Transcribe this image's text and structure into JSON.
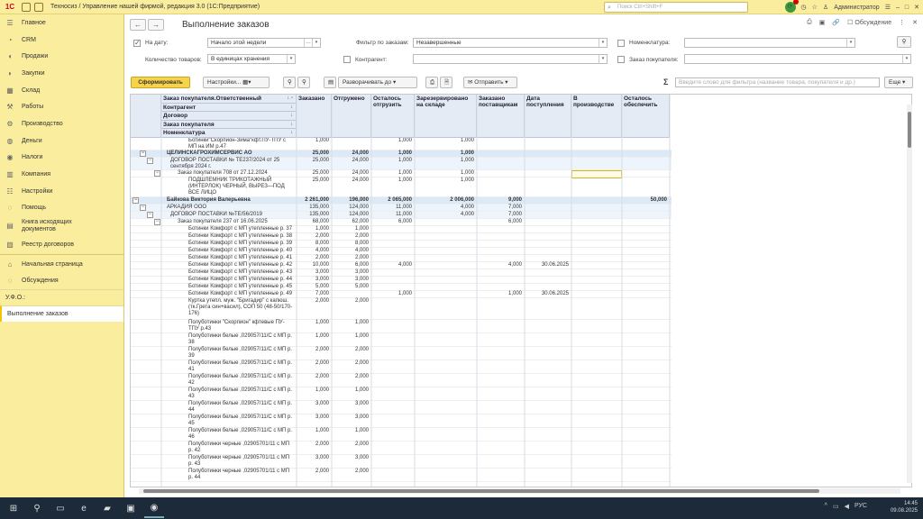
{
  "app": {
    "title": "Техносиз / Управление нашей фирмой, редакция 3.0  (1С:Предприятие)",
    "search_placeholder": "Поиск Ctrl+Shift+F",
    "user": "Администратор",
    "notif_count": "1",
    "logo": "1С"
  },
  "sidebar": {
    "items": [
      {
        "label": "Главное",
        "icon": "menu-icon"
      },
      {
        "label": "CRM",
        "icon": "crm-icon"
      },
      {
        "label": "Продажи",
        "icon": "sales-icon"
      },
      {
        "label": "Закупки",
        "icon": "purchases-icon"
      },
      {
        "label": "Склад",
        "icon": "warehouse-icon"
      },
      {
        "label": "Работы",
        "icon": "works-icon"
      },
      {
        "label": "Производство",
        "icon": "production-icon"
      },
      {
        "label": "Деньги",
        "icon": "money-icon"
      },
      {
        "label": "Налоги",
        "icon": "taxes-icon"
      },
      {
        "label": "Компания",
        "icon": "company-icon"
      },
      {
        "label": "Настройки",
        "icon": "settings-icon"
      },
      {
        "label": "Помощь",
        "icon": "help-icon"
      },
      {
        "label": "Книга исходящих документов",
        "icon": "book-icon"
      },
      {
        "label": "Реестр договоров",
        "icon": "registry-icon"
      }
    ],
    "home": "Начальная страница",
    "discussions": "Обсуждения",
    "open": [
      {
        "label": "У.Ф.О.:"
      },
      {
        "label": "Выполнение заказов"
      }
    ]
  },
  "page": {
    "title": "Выполнение заказов",
    "discussion": "Обсуждение"
  },
  "filters": {
    "on_date_label": "На дату:",
    "on_date_value": "Начало этой недели",
    "filter_orders_label": "Фильтр по заказам:",
    "filter_orders_value": "Незавершенные",
    "nomenclature_label": "Номенклатура:",
    "qty_label": "Количество товаров:",
    "qty_value": "В единицах хранения",
    "counterparty_label": "Контрагент:",
    "customer_order_label": "Заказ покупателя:"
  },
  "toolbar": {
    "generate": "Сформировать",
    "settings": "Настройки...",
    "expand": "Разворачивать до",
    "send": "Отправить",
    "search_placeholder": "Введите слово для фильтра (название товара, покупателя и др.)",
    "more": "Еще"
  },
  "grid": {
    "group_headers": [
      "Заказ покупателя.Ответственный",
      "Контрагент",
      "Договор",
      "Заказ покупателя",
      "Номенклатура"
    ],
    "columns": [
      "Заказано",
      "Отгружено",
      "Осталось отгрузить",
      "Зарезервировано на складе",
      "Заказано поставщикам",
      "Дата поступления",
      "В производстве",
      "Осталось обеспечить"
    ],
    "rows": [
      {
        "lvl": 4,
        "name": "Ботинки\"Скорпион-Зима\"кфт.ПУ-ТПУ с МП на ИМ р.47",
        "v": [
          "1,000",
          "",
          "1,000",
          "1,000",
          "",
          "",
          "",
          ""
        ],
        "h": 14
      },
      {
        "lvl": 1,
        "cls": "lvl1",
        "name": "ЦЕЛИНСКАГРОХИМСЕРВИС АО",
        "v": [
          "25,000",
          "24,000",
          "1,000",
          "1,000",
          "",
          "",
          "",
          ""
        ],
        "h": 8
      },
      {
        "lvl": 2,
        "cls": "lvl2",
        "name": "ДОГОВОР ПОСТАВКИ № ТЕ237/2024 от 25 сентября 2024 г.",
        "v": [
          "25,000",
          "24,000",
          "1,000",
          "1,000",
          "",
          "",
          "",
          ""
        ],
        "h": 14
      },
      {
        "lvl": 3,
        "name": "Заказ покупателя 708 от 27.12.2024",
        "v": [
          "25,000",
          "24,000",
          "1,000",
          "1,000",
          "",
          "",
          "",
          ""
        ],
        "h": 8
      },
      {
        "lvl": 4,
        "name": "ПОДШЛЕМНИК ТРИКОТАЖНЫЙ (ИНТЕРЛОК) ЧЕРНЫЙ, ВЫРЕЗ—ПОД ВСЕ ЛИЦО",
        "v": [
          "25,000",
          "24,000",
          "1,000",
          "1,000",
          "",
          "",
          "",
          ""
        ],
        "h": 22
      },
      {
        "lvl": 0,
        "cls": "lvl1",
        "name": "Байкова Виктория Валерьевна",
        "v": [
          "2 261,000",
          "196,000",
          "2 065,000",
          "2 006,000",
          "9,000",
          "",
          "",
          "50,000"
        ],
        "h": 8
      },
      {
        "lvl": 1,
        "cls": "lvl2",
        "name": "АРКАДИЯ ООО",
        "v": [
          "135,000",
          "124,000",
          "11,000",
          "4,000",
          "7,000",
          "",
          "",
          ""
        ],
        "h": 8
      },
      {
        "lvl": 2,
        "cls": "lvl2b",
        "name": "ДОГОВОР ПОСТАВКИ №ТЕ/56/2019",
        "v": [
          "135,000",
          "124,000",
          "11,000",
          "4,000",
          "7,000",
          "",
          "",
          ""
        ],
        "h": 8
      },
      {
        "lvl": 3,
        "name": "Заказ покупателя 237 от 16.06.2025",
        "v": [
          "68,000",
          "62,000",
          "6,000",
          "",
          "6,000",
          "",
          "",
          ""
        ],
        "h": 8
      },
      {
        "lvl": 4,
        "name": "Ботинки Комфорт с МП утепленные р. 37",
        "v": [
          "1,000",
          "1,000",
          "",
          "",
          "",
          "",
          "",
          ""
        ],
        "h": 8
      },
      {
        "lvl": 4,
        "name": "Ботинки Комфорт с МП утепленные р. 38",
        "v": [
          "2,000",
          "2,000",
          "",
          "",
          "",
          "",
          "",
          ""
        ],
        "h": 8
      },
      {
        "lvl": 4,
        "name": "Ботинки Комфорт с МП утепленные р. 39",
        "v": [
          "8,000",
          "8,000",
          "",
          "",
          "",
          "",
          "",
          ""
        ],
        "h": 8
      },
      {
        "lvl": 4,
        "name": "Ботинки Комфорт с МП утепленные р. 40",
        "v": [
          "4,000",
          "4,000",
          "",
          "",
          "",
          "",
          "",
          ""
        ],
        "h": 8
      },
      {
        "lvl": 4,
        "name": "Ботинки Комфорт с МП утепленные р. 41",
        "v": [
          "2,000",
          "2,000",
          "",
          "",
          "",
          "",
          "",
          ""
        ],
        "h": 8
      },
      {
        "lvl": 4,
        "name": "Ботинки Комфорт с МП утепленные р. 42",
        "v": [
          "10,000",
          "6,000",
          "4,000",
          "",
          "4,000",
          "30.06.2025",
          "",
          ""
        ],
        "h": 8
      },
      {
        "lvl": 4,
        "name": "Ботинки Комфорт с МП утепленные р. 43",
        "v": [
          "3,000",
          "3,000",
          "",
          "",
          "",
          "",
          "",
          ""
        ],
        "h": 8
      },
      {
        "lvl": 4,
        "name": "Ботинки Комфорт с МП утепленные р. 44",
        "v": [
          "3,000",
          "3,000",
          "",
          "",
          "",
          "",
          "",
          ""
        ],
        "h": 8
      },
      {
        "lvl": 4,
        "name": "Ботинки Комфорт с МП утепленные р. 45",
        "v": [
          "5,000",
          "5,000",
          "",
          "",
          "",
          "",
          "",
          ""
        ],
        "h": 8
      },
      {
        "lvl": 4,
        "name": "Ботинки Комфорт с МП утепленные р. 49",
        "v": [
          "7,000",
          "",
          "1,000",
          "",
          "1,000",
          "30.06.2025",
          "",
          ""
        ],
        "h": 8
      },
      {
        "lvl": 4,
        "name": "Куртка утепл. муж. \"Бригадир\" с капюш. (тк.Грета син+васил), СОП 50 (48-50/170-176)",
        "v": [
          "2,000",
          "2,000",
          "",
          "",
          "",
          "",
          "",
          ""
        ],
        "h": 24
      },
      {
        "lvl": 4,
        "name": "Полуботинки \"Скорпион\" кфтевые ПУ-ТПУ р.43",
        "v": [
          "1,000",
          "1,000",
          "",
          "",
          "",
          "",
          "",
          ""
        ],
        "h": 15
      },
      {
        "lvl": 4,
        "name": "Полуботинки белые ,029057/11/С с МП р. 38",
        "v": [
          "1,000",
          "1,000",
          "",
          "",
          "",
          "",
          "",
          ""
        ],
        "h": 15
      },
      {
        "lvl": 4,
        "name": "Полуботинки белые ,029057/11/С с МП р. 39",
        "v": [
          "2,000",
          "2,000",
          "",
          "",
          "",
          "",
          "",
          ""
        ],
        "h": 15
      },
      {
        "lvl": 4,
        "name": "Полуботинки белые ,029057/11/С с МП р. 41",
        "v": [
          "2,000",
          "2,000",
          "",
          "",
          "",
          "",
          "",
          ""
        ],
        "h": 15
      },
      {
        "lvl": 4,
        "name": "Полуботинки белые ,029057/11/С с МП р. 42",
        "v": [
          "2,000",
          "2,000",
          "",
          "",
          "",
          "",
          "",
          ""
        ],
        "h": 15
      },
      {
        "lvl": 4,
        "name": "Полуботинки белые ,029057/11/С с МП р. 43",
        "v": [
          "1,000",
          "1,000",
          "",
          "",
          "",
          "",
          "",
          ""
        ],
        "h": 15
      },
      {
        "lvl": 4,
        "name": "Полуботинки белые ,029057/11/С с МП р. 44",
        "v": [
          "3,000",
          "3,000",
          "",
          "",
          "",
          "",
          "",
          ""
        ],
        "h": 15
      },
      {
        "lvl": 4,
        "name": "Полуботинки белые ,029057/11/С с МП р. 45",
        "v": [
          "3,000",
          "3,000",
          "",
          "",
          "",
          "",
          "",
          ""
        ],
        "h": 15
      },
      {
        "lvl": 4,
        "name": "Полуботинки белые ,029057/11/С с МП р. 46",
        "v": [
          "1,000",
          "1,000",
          "",
          "",
          "",
          "",
          "",
          ""
        ],
        "h": 15
      },
      {
        "lvl": 4,
        "name": "Полуботинки черные ,02905701/11 с МП р. 42",
        "v": [
          "2,000",
          "2,000",
          "",
          "",
          "",
          "",
          "",
          ""
        ],
        "h": 15
      },
      {
        "lvl": 4,
        "name": "Полуботинки черные ,02905701/11 с МП р. 43",
        "v": [
          "3,000",
          "3,000",
          "",
          "",
          "",
          "",
          "",
          ""
        ],
        "h": 15
      },
      {
        "lvl": 4,
        "name": "Полуботинки черные ,02905701/11 с МП р. 44",
        "v": [
          "2,000",
          "2,000",
          "",
          "",
          "",
          "",
          "",
          ""
        ],
        "h": 15
      }
    ]
  },
  "taskbar": {
    "time": "14:45",
    "date": "09.08.2025",
    "lang": "РУС"
  }
}
